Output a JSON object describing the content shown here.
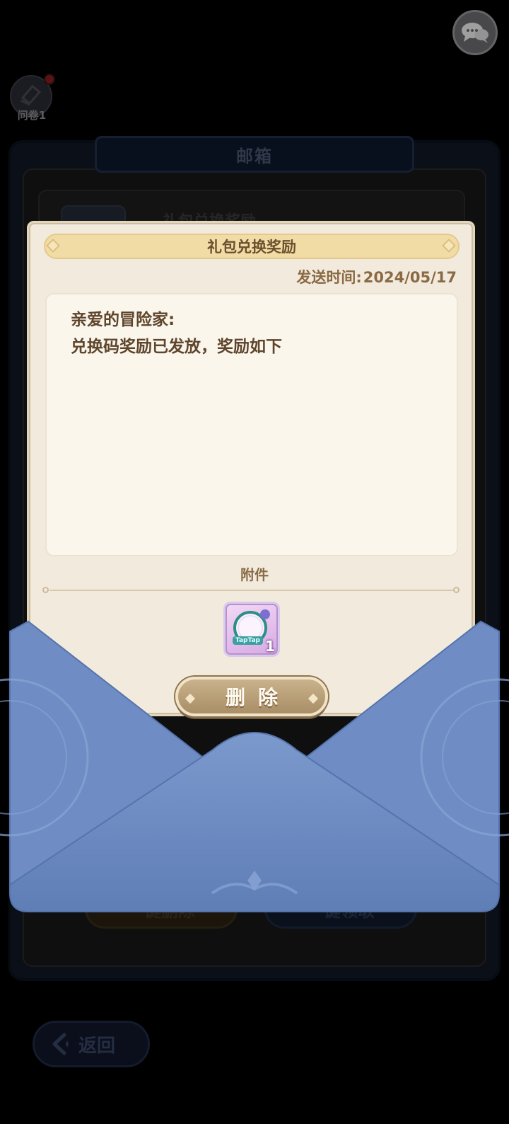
{
  "top": {
    "chat_icon": "chat-bubbles-icon",
    "survey_label": "问卷1"
  },
  "mailbox": {
    "title": "邮箱",
    "mail_item_label": "礼包兑换奖励",
    "delete_all_label": "一键删除",
    "claim_all_label": "一键领取",
    "back_label": "返回"
  },
  "letter": {
    "title": "礼包兑换奖励",
    "send_time_label": "发送时间:",
    "send_time_value": "2024/05/17",
    "body_lines": [
      "亲爱的冒险家:",
      "兑换码奖励已发放，奖励如下"
    ],
    "attachment_label": "附件",
    "attachment": {
      "quantity": "1",
      "tag": "TapTap",
      "icon": "avatar-frame-icon"
    },
    "delete_label": "删除"
  },
  "colors": {
    "envelope_blue": "#7693c8",
    "letter_bg": "#f2ebdd",
    "title_bar": "#f1dca6",
    "delete_button": "#b89c72"
  }
}
